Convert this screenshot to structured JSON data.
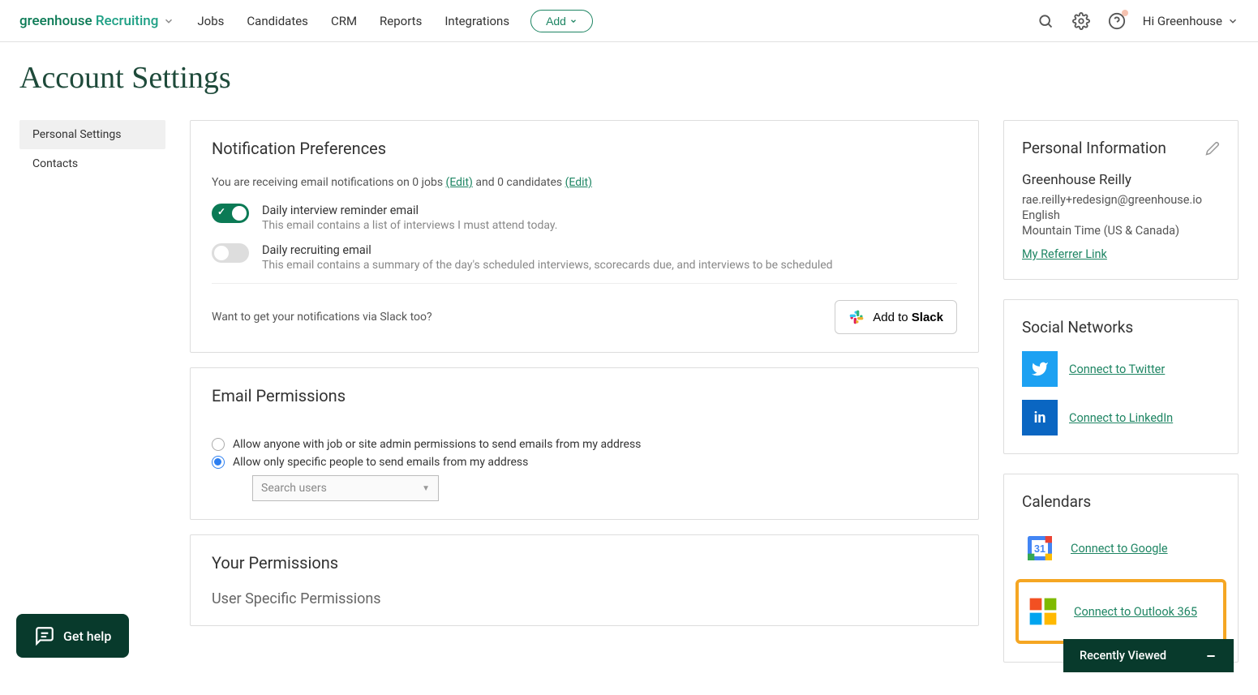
{
  "logo": {
    "part1": "greenhouse",
    "part2": "Recruiting"
  },
  "nav": {
    "jobs": "Jobs",
    "candidates": "Candidates",
    "crm": "CRM",
    "reports": "Reports",
    "integrations": "Integrations"
  },
  "add_btn": "Add",
  "user_menu": "Hi Greenhouse",
  "page_title": "Account Settings",
  "sidebar": {
    "personal": "Personal Settings",
    "contacts": "Contacts"
  },
  "notif": {
    "heading": "Notification Preferences",
    "text_prefix": "You are receiving email notifications on 0 jobs ",
    "edit1": "(Edit)",
    "text_mid": " and 0 candidates ",
    "edit2": "(Edit)",
    "toggle1_label": "Daily interview reminder email",
    "toggle1_desc": "This email contains a list of interviews I must attend today.",
    "toggle2_label": "Daily recruiting email",
    "toggle2_desc": "This email contains a summary of the day's scheduled interviews, scorecards due, and interviews to be scheduled",
    "slack_text": "Want to get your notifications via Slack too?",
    "slack_btn_prefix": "Add to ",
    "slack_btn_bold": "Slack"
  },
  "email_perm": {
    "heading": "Email Permissions",
    "opt1": "Allow anyone with job or site admin permissions to send emails from my address",
    "opt2": "Allow only specific people to send emails from my address",
    "search_placeholder": "Search users"
  },
  "your_perm": {
    "heading": "Your Permissions",
    "sub": "User Specific Permissions"
  },
  "personal_info": {
    "heading": "Personal Information",
    "name": "Greenhouse Reilly",
    "email": "rae.reilly+redesign@greenhouse.io",
    "lang": "English",
    "tz": "Mountain Time (US & Canada)",
    "referrer": "My Referrer Link"
  },
  "social": {
    "heading": "Social Networks",
    "twitter": "Connect to Twitter",
    "linkedin": "Connect to LinkedIn"
  },
  "calendars": {
    "heading": "Calendars",
    "google": "Connect to Google",
    "outlook": "Connect to Outlook 365"
  },
  "get_help": "Get help",
  "recently_viewed": "Recently Viewed"
}
